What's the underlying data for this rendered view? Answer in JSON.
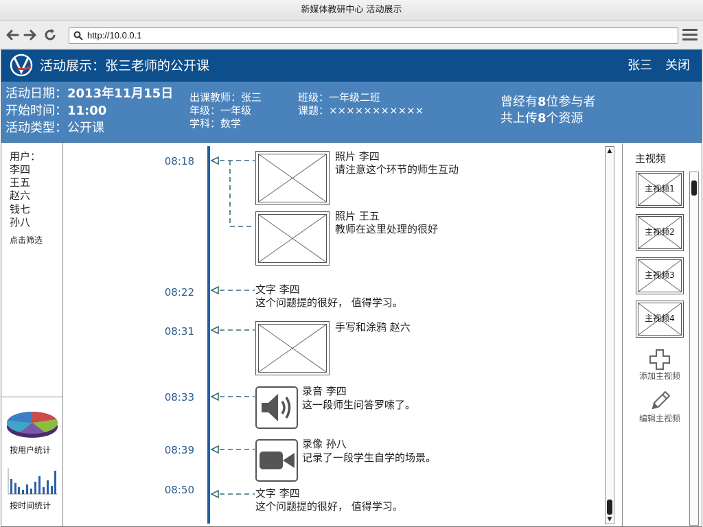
{
  "browser": {
    "window_title": "新媒体教研中心 活动展示",
    "url": "http://10.0.0.1",
    "icons": [
      "back-arrow-icon",
      "forward-arrow-icon",
      "reload-icon",
      "search-icon",
      "hamburger-menu-icon"
    ]
  },
  "header": {
    "title": "活动展示：张三老师的公开课",
    "user": "张三",
    "close_label": "关闭",
    "brand_color": "#0d4f8d"
  },
  "info": {
    "date_label": "活动日期：",
    "date_value": "2013年11月15日",
    "start_label": "开始时间：",
    "start_value": "11:00",
    "type_label": "活动类型：",
    "type_value": "公开课",
    "teacher": "出课教师：张三",
    "grade": "年级：一年级",
    "subject": "学科：数学",
    "class": "班级：一年级二班",
    "topic": "课题：×××××××××××",
    "participants_prefix": "曾经有",
    "participants_count": "8",
    "participants_suffix": "位参与者",
    "resources_prefix": "共上传",
    "resources_count": "8",
    "resources_suffix": "个资源",
    "band_color": "#4a83bb"
  },
  "left": {
    "users_label": "用户：",
    "users": [
      "李四",
      "王五",
      "赵六",
      "钱七",
      "孙八"
    ],
    "filter_label": "点击筛选",
    "stat_by_user": "按用户统计",
    "stat_by_time": "按时间统计"
  },
  "timeline": {
    "entries": [
      {
        "time": "08:18",
        "title": "照片 李四",
        "text": "请注意这个环节的师生互动"
      },
      {
        "time": "",
        "title": "照片 王五",
        "text": "教师在这里处理的很好"
      },
      {
        "time": "08:22",
        "title": "文字 李四",
        "text": "这个问题提的很好，  值得学习。"
      },
      {
        "time": "08:31",
        "title": "手写和涂鸦 赵六",
        "text": ""
      },
      {
        "time": "08:33",
        "title": "录音 李四",
        "text": "这一段师生问答罗嗦了。"
      },
      {
        "time": "08:39",
        "title": "录像 孙八",
        "text": "记录了一段学生自学的场景。"
      },
      {
        "time": "08:50",
        "title": "文字 李四",
        "text": "这个问题提的很好，  值得学习。"
      }
    ]
  },
  "right": {
    "title": "主视频",
    "videos": [
      "主视频1",
      "主视频2",
      "主视频3",
      "主视频4"
    ],
    "add_label": "添加主视频",
    "edit_label": "编辑主视频"
  }
}
